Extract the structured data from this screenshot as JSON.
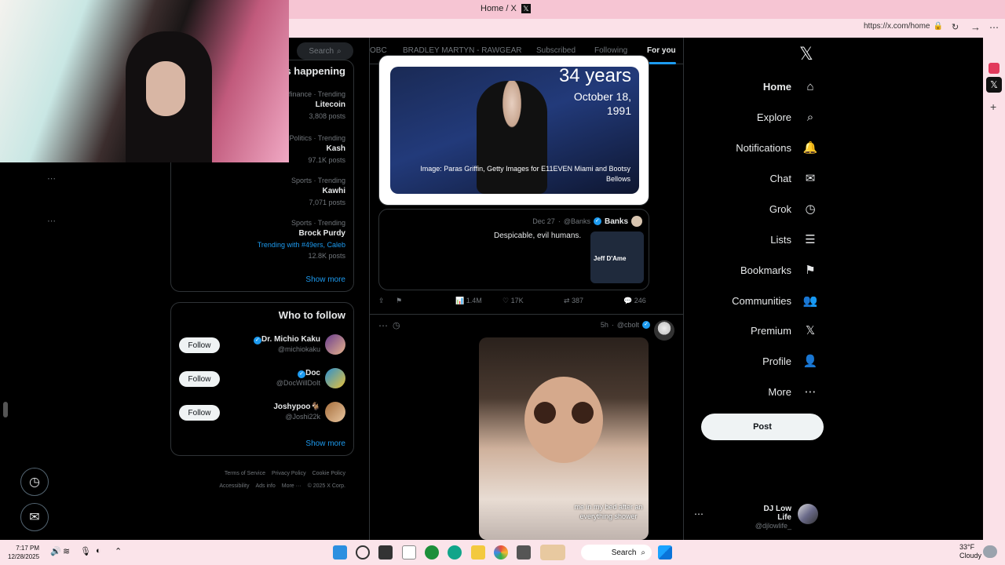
{
  "browser": {
    "tab_title": "Home / X",
    "url": "https://x.com/home"
  },
  "nav": {
    "items": [
      {
        "label": "Home",
        "icon": "home-icon",
        "glyph": "⌂"
      },
      {
        "label": "Explore",
        "icon": "search-icon",
        "glyph": "⌕"
      },
      {
        "label": "Notifications",
        "icon": "bell-icon",
        "glyph": "🔔"
      },
      {
        "label": "Chat",
        "icon": "mail-icon",
        "glyph": "✉"
      },
      {
        "label": "Grok",
        "icon": "grok-icon",
        "glyph": "◷"
      },
      {
        "label": "Lists",
        "icon": "list-icon",
        "glyph": "☰"
      },
      {
        "label": "Bookmarks",
        "icon": "bookmark-icon",
        "glyph": "⚑"
      },
      {
        "label": "Communities",
        "icon": "people-icon",
        "glyph": "👥"
      },
      {
        "label": "Premium",
        "icon": "x-logo-icon",
        "glyph": "𝕏"
      },
      {
        "label": "Profile",
        "icon": "person-icon",
        "glyph": "👤"
      },
      {
        "label": "More",
        "icon": "more-circle-icon",
        "glyph": "⋯"
      }
    ],
    "post_label": "Post",
    "account": {
      "name": "DJ Low Life",
      "handle": "@djlowlife_"
    }
  },
  "feed": {
    "tabs": [
      "For you",
      "Following",
      "Subscribed",
      "BRADLEY MARTYN - RAWGEAR",
      "OBC"
    ],
    "media_overlay": {
      "title": "34 years",
      "line2": "October 18,",
      "line3": "1991",
      "caption": "Image: Paras Griffin, Getty Images for E11EVEN Miami and Bootsy Bellows"
    },
    "quote": {
      "name": "Banks",
      "handle": "@Banks",
      "date": "Dec 27",
      "text": "Despicable, evil humans.",
      "thumb_text": "Jeff D'Ame"
    },
    "actions": {
      "replies": "246",
      "reposts": "387",
      "likes": "17K",
      "views": "1.4M"
    },
    "post2": {
      "handle": "@cbolt",
      "age": "5h",
      "caption": "me in my bed after an everything shower"
    }
  },
  "sidebar": {
    "search_placeholder": "Search",
    "whats_happening": "What's happening",
    "trends": [
      {
        "context": "Business and finance · Trending",
        "name": "Litecoin",
        "posts": "3,808 posts"
      },
      {
        "context": "Politics · Trending",
        "name": "Kash",
        "posts": "97.1K posts"
      },
      {
        "context": "Sports · Trending",
        "name": "Kawhi",
        "posts": "7,071 posts"
      },
      {
        "context": "Sports · Trending",
        "name": "Brock Purdy",
        "extra": "Trending with #49ers, Caleb",
        "posts": "12.8K posts"
      }
    ],
    "show_more": "Show more",
    "who_to_follow": "Who to follow",
    "follow_label": "Follow",
    "suggestions": [
      {
        "name": "Dr. Michio Kaku",
        "handle": "@michiokaku",
        "verified": true
      },
      {
        "name": "Doc",
        "handle": "@DocWillDoIt",
        "verified": true
      },
      {
        "name": "Joshypoo🐐",
        "handle": "@Joshi22k",
        "verified": false
      }
    ],
    "show_more_2": "Show more",
    "footer_line1": [
      "Terms of Service",
      "Privacy Policy",
      "Cookie Policy"
    ],
    "footer_line2": [
      "Accessibility",
      "Ads info",
      "More ···",
      "© 2025 X Corp."
    ]
  },
  "taskbar": {
    "search_label": "Search",
    "time": "7:17 PM",
    "date": "12/28/2025",
    "weather_temp": "33°F",
    "weather_desc": "Cloudy"
  },
  "colors": {
    "accent": "#1d9bf0",
    "bg": "#000000",
    "chrome": "#f6c5d3"
  }
}
